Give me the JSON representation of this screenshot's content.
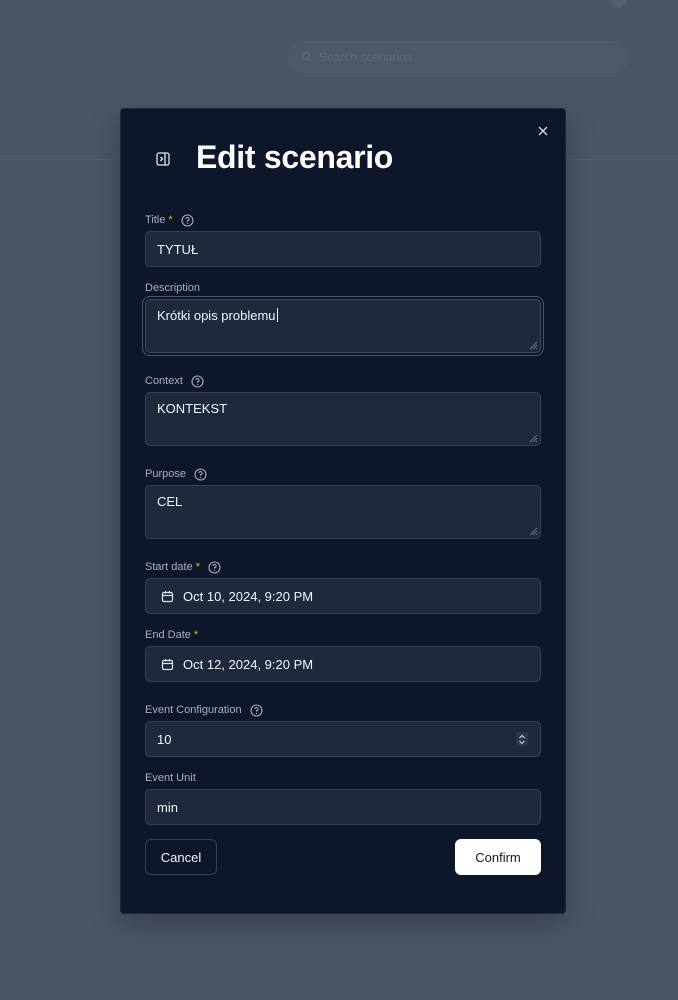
{
  "backdrop": {
    "search_placeholder": "Search scenarios"
  },
  "dialog": {
    "title": "Edit scenario",
    "fields": {
      "title": {
        "label": "Title",
        "required_mark": "*",
        "value": "TYTUŁ"
      },
      "description": {
        "label": "Description",
        "value": "Krótki opis problemu"
      },
      "context": {
        "label": "Context",
        "value": "KONTEKST"
      },
      "purpose": {
        "label": "Purpose",
        "value": "CEL"
      },
      "start_date": {
        "label": "Start date",
        "required_mark": "*",
        "value": "Oct 10, 2024, 9:20 PM"
      },
      "end_date": {
        "label": "End Date",
        "required_mark": "*",
        "value": "Oct 12, 2024, 9:20 PM"
      },
      "event_configuration": {
        "label": "Event Configuration",
        "value": "10"
      },
      "event_unit": {
        "label": "Event Unit",
        "value": "min"
      }
    },
    "buttons": {
      "cancel": "Cancel",
      "confirm": "Confirm"
    }
  },
  "colors": {
    "backdrop": "#4b5566",
    "dialog_bg": "#0e1729",
    "input_bg": "#1e293b",
    "required_accent": "#f5b400",
    "confirm_bg": "#ffffff"
  },
  "icons": [
    "search-icon",
    "close-icon",
    "sidebar-toggle-icon",
    "help-circle-icon",
    "calendar-icon",
    "chevron-up-down-icon",
    "resize-grip-icon"
  ]
}
